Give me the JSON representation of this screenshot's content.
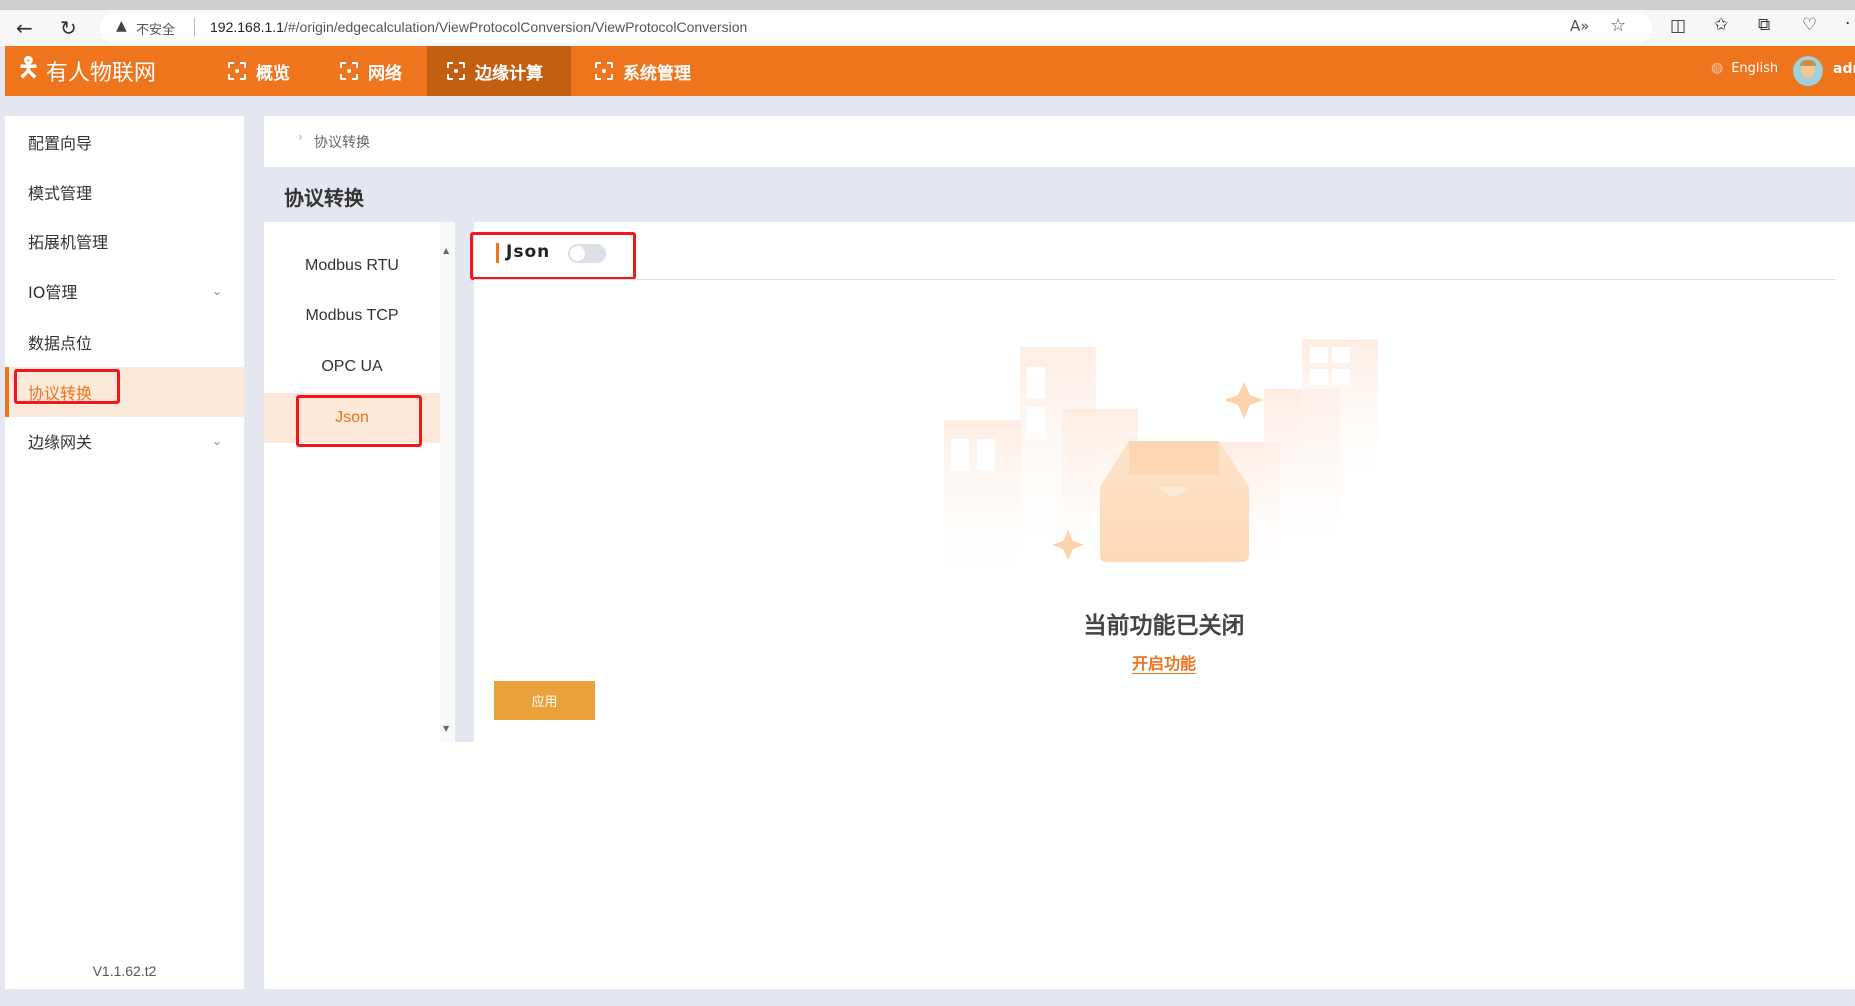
{
  "browser": {
    "security_label": "不安全",
    "url_host": "192.168.1.1",
    "url_path": "/#/origin/edgecalculation/ViewProtocolConversion/ViewProtocolConversion"
  },
  "header": {
    "logo": "有人物联网",
    "nav": [
      {
        "label": "概览"
      },
      {
        "label": "网络"
      },
      {
        "label": "边缘计算",
        "active": true
      },
      {
        "label": "系统管理"
      }
    ],
    "language": "English",
    "user": "adm"
  },
  "sidebar": {
    "items": [
      {
        "label": "配置向导"
      },
      {
        "label": "模式管理"
      },
      {
        "label": "拓展机管理"
      },
      {
        "label": "IO管理",
        "expandable": true
      },
      {
        "label": "数据点位"
      },
      {
        "label": "协议转换",
        "active": true
      },
      {
        "label": "边缘网关",
        "expandable": true
      }
    ],
    "version": "V1.1.62.t2"
  },
  "breadcrumb": "协议转换",
  "page_title": "协议转换",
  "protocols": [
    {
      "label": "Modbus RTU"
    },
    {
      "label": "Modbus TCP"
    },
    {
      "label": "OPC UA"
    },
    {
      "label": "Json",
      "active": true
    }
  ],
  "panel": {
    "title": "Json",
    "toggle_on": false,
    "empty_text": "当前功能已关闭",
    "enable_link": "开启功能",
    "apply_label": "应用"
  },
  "colors": {
    "brand": "#ee741e",
    "active_nav": "#c45f12",
    "apply": "#e9a23b",
    "highlight": "#f5151a"
  }
}
